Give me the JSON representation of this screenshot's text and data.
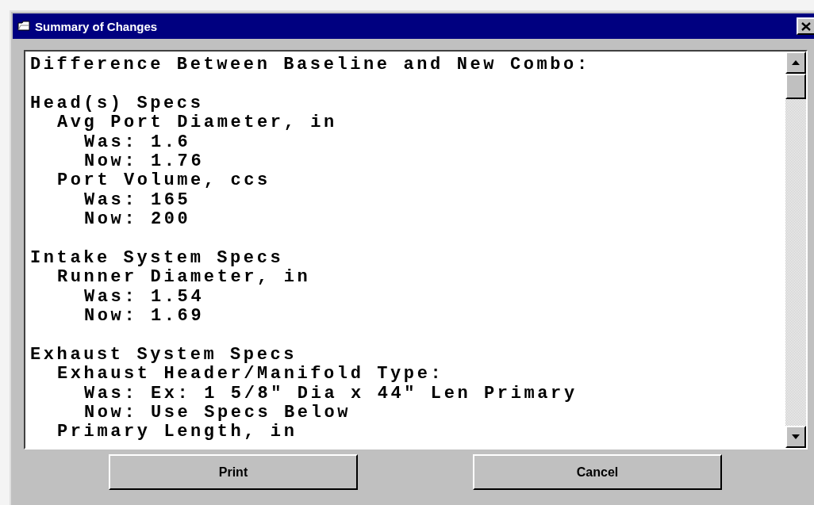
{
  "window": {
    "title": "Summary of Changes"
  },
  "summary": {
    "heading": "Difference Between Baseline and New Combo:",
    "sections": [
      {
        "title": "Head(s) Specs",
        "children": [
          {
            "label": "Avg Port Diameter, in",
            "children": [
              "Was: 1.6",
              "Now: 1.76"
            ]
          },
          {
            "label": "Port Volume, ccs",
            "children": [
              "Was: 165",
              "Now: 200"
            ]
          }
        ]
      },
      {
        "title": "Intake System Specs",
        "children": [
          {
            "label": "Runner Diameter, in",
            "children": [
              "Was: 1.54",
              "Now: 1.69"
            ]
          }
        ]
      },
      {
        "title": "Exhaust System Specs",
        "children": [
          {
            "label": "Exhaust Header/Manifold Type:",
            "children": [
              "Was: Ex: 1 5/8\" Dia x 44\" Len Primary",
              "Now: Use Specs Below"
            ]
          },
          {
            "label": "Primary Length, in"
          }
        ]
      }
    ]
  },
  "buttons": [
    "Print",
    "Cancel"
  ]
}
